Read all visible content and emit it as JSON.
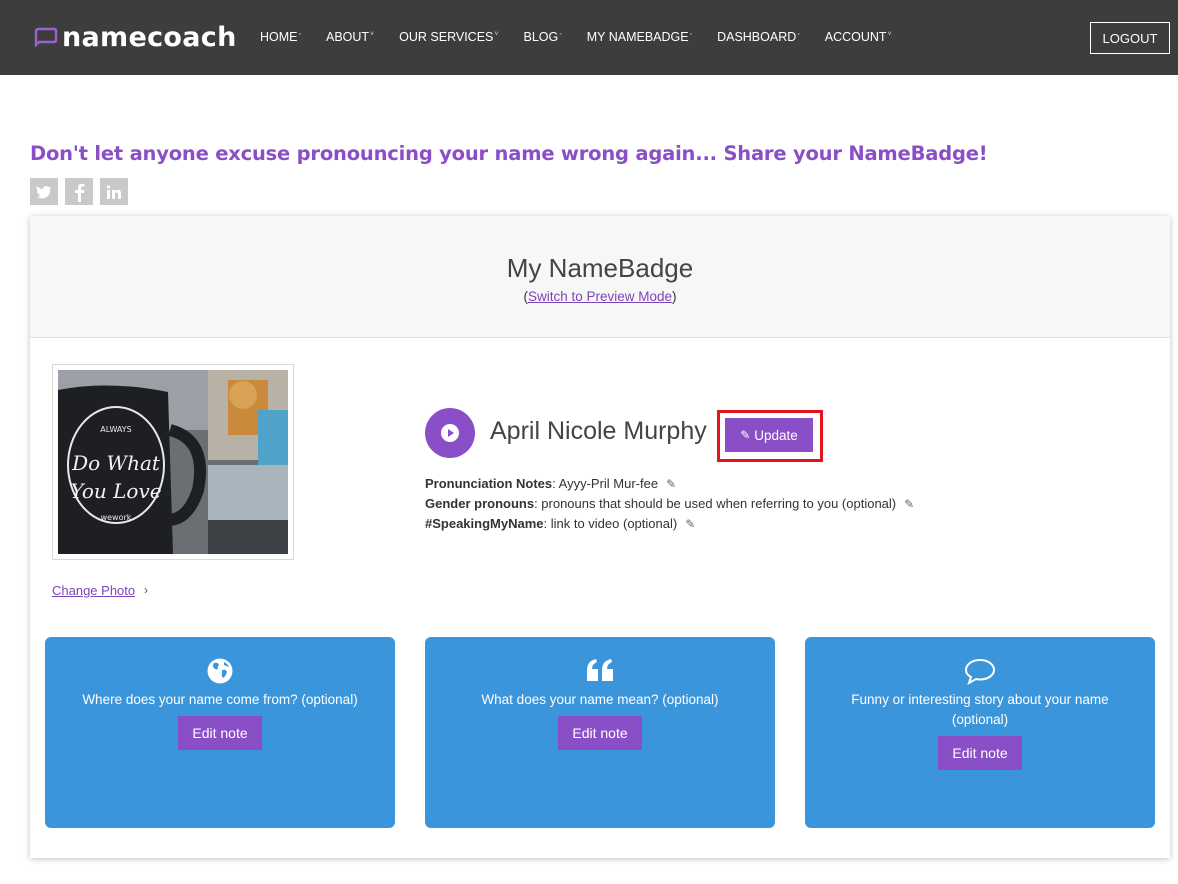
{
  "header": {
    "logo_text": "namecoach",
    "nav": [
      {
        "label": "HOME",
        "mark": "◦"
      },
      {
        "label": "ABOUT",
        "mark": "˅"
      },
      {
        "label": "OUR SERVICES",
        "mark": "˅"
      },
      {
        "label": "BLOG",
        "mark": "◦"
      },
      {
        "label": "MY NAMEBADGE",
        "mark": "◦"
      },
      {
        "label": "DASHBOARD",
        "mark": "◦"
      },
      {
        "label": "ACCOUNT",
        "mark": "˅"
      }
    ],
    "logout_label": "LOGOUT"
  },
  "tagline": "Don't let anyone excuse pronouncing your name wrong again... Share your NameBadge!",
  "share": [
    "twitter-icon",
    "facebook-icon",
    "linkedin-icon"
  ],
  "badge": {
    "title": "My NameBadge",
    "preview_open": "(",
    "preview_link": "Switch to Preview Mode",
    "preview_close": ")",
    "change_photo": "Change Photo",
    "full_name": "April Nicole Murphy",
    "update_label": "Update",
    "notes": [
      {
        "label": "Pronunciation Notes",
        "value": ": Ayyy-Pril Mur-fee"
      },
      {
        "label": "Gender pronouns",
        "value": ": pronouns that should be used when referring to you (optional)"
      },
      {
        "label": "#SpeakingMyName",
        "value": ": link to video (optional)"
      }
    ],
    "tiles": [
      {
        "icon": "globe-icon",
        "text": "Where does your name come from? (optional)",
        "button": "Edit note"
      },
      {
        "icon": "quote-icon",
        "text": "What does your name mean? (optional)",
        "button": "Edit note"
      },
      {
        "icon": "speech-bubble-icon",
        "text": "Funny or interesting story about your name (optional)",
        "button": "Edit note"
      }
    ]
  },
  "colors": {
    "topbar": "#3d3d3d",
    "brand_purple": "#8a4fc6",
    "tile_blue": "#3b95db",
    "highlight_red": "#e8141c"
  }
}
